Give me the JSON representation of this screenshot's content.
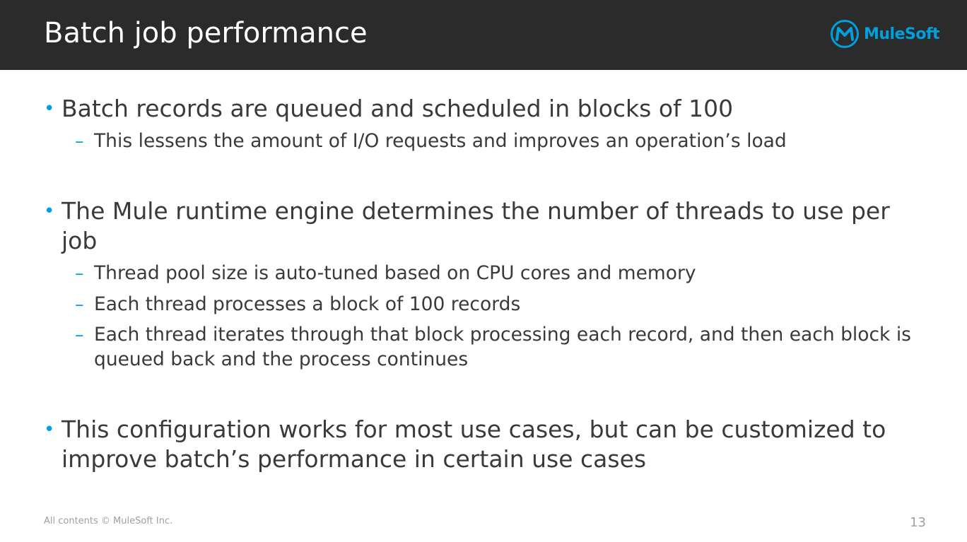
{
  "slide": {
    "title": "Batch job performance",
    "logo_text": "MuleSoft",
    "logo_icon": "mulesoft-m-logo-icon",
    "accent_color": "#00a0df",
    "header_color": "#2b2b2b"
  },
  "bullets": [
    {
      "marker": "•",
      "text": "Batch records are queued and scheduled in blocks of 100",
      "subs": [
        {
          "marker": "–",
          "text": "This lessens the amount of I/O requests and improves an operation’s load"
        }
      ]
    },
    {
      "marker": "•",
      "text": "The Mule runtime engine determines the number of threads to use per job",
      "subs": [
        {
          "marker": "–",
          "text": "Thread pool size is auto-tuned based on CPU cores and memory"
        },
        {
          "marker": "–",
          "text": "Each thread processes a block of 100 records"
        },
        {
          "marker": "–",
          "text": "Each thread iterates through that block processing each record, and then each block is queued back and the process continues"
        }
      ]
    },
    {
      "marker": "•",
      "text": "This configuration works for most use cases, but can be customized to improve batch’s performance in certain use cases",
      "subs": []
    }
  ],
  "footer": {
    "copyright": "All contents © MuleSoft Inc.",
    "page_number": "13"
  }
}
